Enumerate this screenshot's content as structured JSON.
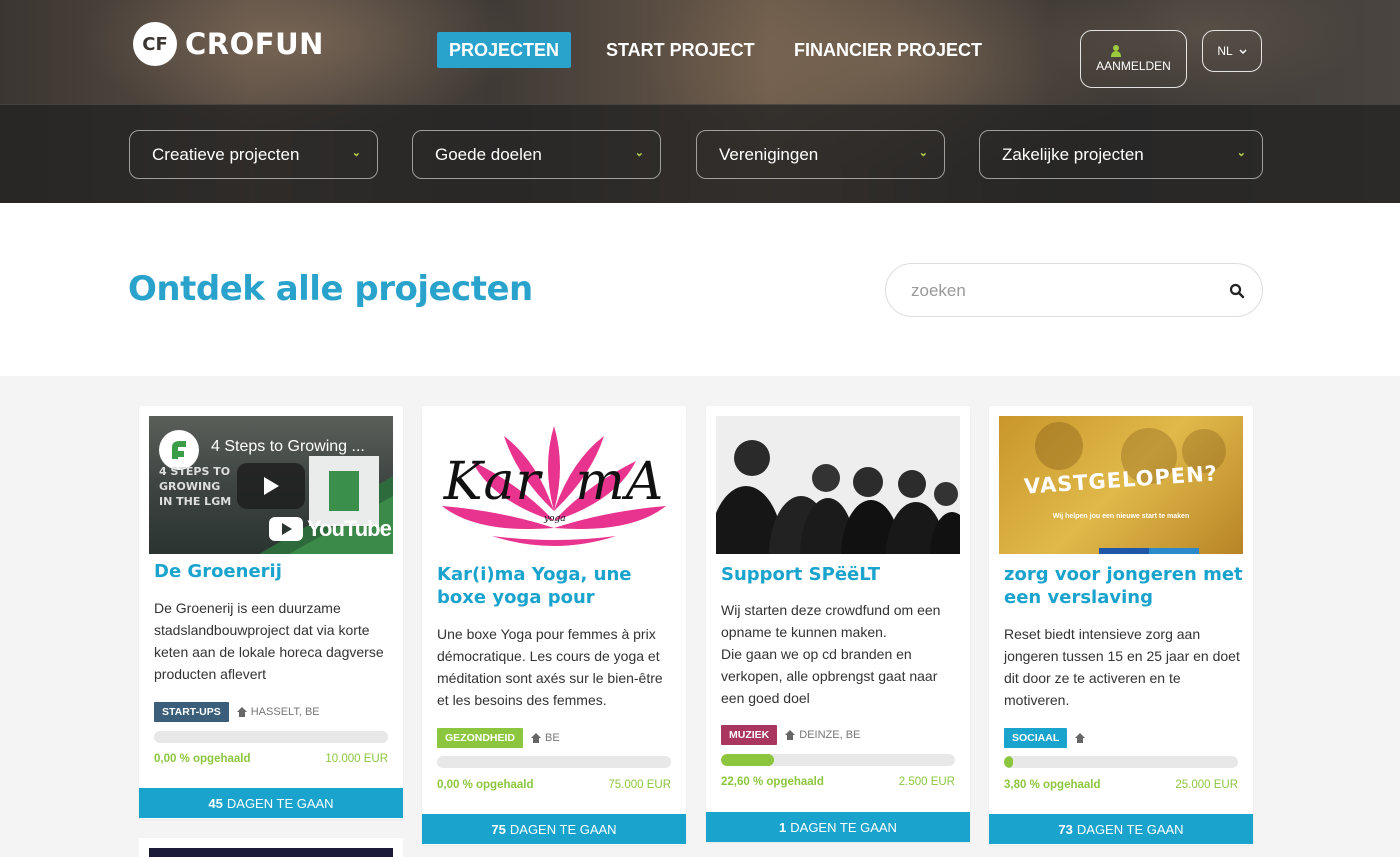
{
  "header": {
    "logo_mark": "CF",
    "logo_text": "CROFUN",
    "nav": [
      {
        "label": "PROJECTEN",
        "active": true
      },
      {
        "label": "START PROJECT",
        "active": false
      },
      {
        "label": "FINANCIER PROJECT",
        "active": false
      }
    ],
    "login_label": "AANMELDEN",
    "lang_label": "NL"
  },
  "filters": [
    {
      "label": "Creatieve projecten"
    },
    {
      "label": "Goede doelen"
    },
    {
      "label": "Verenigingen"
    },
    {
      "label": "Zakelijke projecten"
    }
  ],
  "discover": {
    "title": "Ontdek alle projecten",
    "search_placeholder": "zoeken",
    "search_value": ""
  },
  "cards": [
    {
      "video_title": "4 Steps to Growing ...",
      "video_overlay_lines": [
        "4 STEPS TO",
        "GROWING",
        "IN THE LGM"
      ],
      "video_brand": "YouTube",
      "title": "De Groenerij",
      "description": "De Groenerij is een duurzame stadslandbouwproject dat via korte keten aan de lokale horeca dagverse producten aflevert",
      "category": "START-UPS",
      "category_color": "#3b5f7a",
      "location": "HASSELT, BE",
      "progress": 0.0,
      "percent_label": "0,00 % opgehaald",
      "goal_label": "10.000 EUR",
      "days": "45",
      "days_suffix": "DAGEN TE GAAN"
    },
    {
      "logo_text_left": "Kar",
      "logo_text_right": "mA",
      "logo_sub": "yoga",
      "title": "Kar(i)ma Yoga, une boxe yoga pour",
      "description": "Une boxe Yoga pour femmes à prix démocratique. Les cours de yoga et méditation sont axés sur le bien-être et les besoins des femmes.",
      "category": "GEZONDHEID",
      "category_color": "#8cc63f",
      "location": "BE",
      "progress": 0.0,
      "percent_label": "0,00 % opgehaald",
      "goal_label": "75.000 EUR",
      "days": "75",
      "days_suffix": "DAGEN TE GAAN"
    },
    {
      "title": "Support SPëëLT",
      "description": "Wij starten deze crowdfund om een opname te kunnen maken.\nDie gaan we op cd branden en verkopen, alle opbrengst gaat naar een goed doel",
      "category": "MUZIEK",
      "category_color": "#a8365f",
      "location": "DEINZE, BE",
      "progress": 0.226,
      "percent_label": "22,60 % opgehaald",
      "goal_label": "2.500 EUR",
      "days": "1",
      "days_suffix": "DAGEN TE GAAN"
    },
    {
      "image_headline": "VASTGELOPEN?",
      "image_sub": "Wij helpen jou een nieuwe start te maken",
      "title": "zorg voor jongeren met een verslaving",
      "description": "Reset biedt intensieve zorg aan jongeren tussen 15 en 25 jaar en doet dit door ze te activeren en te motiveren.",
      "category": "SOCIAAL",
      "category_color": "#1aa3cc",
      "location": "",
      "progress": 0.038,
      "percent_label": "3,80 % opgehaald",
      "goal_label": "25.000 EUR",
      "days": "73",
      "days_suffix": "DAGEN TE GAAN"
    }
  ],
  "colors": {
    "accent": "#2aa3cc",
    "progress": "#8cc63f",
    "chevron": "#b5d34a"
  }
}
